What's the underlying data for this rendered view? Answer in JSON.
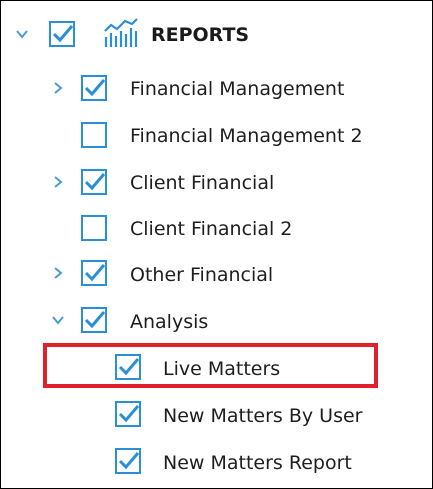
{
  "root": {
    "label": "REPORTS",
    "expanded": true,
    "checked": true,
    "icon": "report-chart-icon"
  },
  "items": [
    {
      "label": "Financial Management",
      "checked": true,
      "has_children": true,
      "expanded": false
    },
    {
      "label": "Financial Management 2",
      "checked": false,
      "has_children": false
    },
    {
      "label": "Client Financial",
      "checked": true,
      "has_children": true,
      "expanded": false
    },
    {
      "label": "Client Financial 2",
      "checked": false,
      "has_children": false
    },
    {
      "label": "Other Financial",
      "checked": true,
      "has_children": true,
      "expanded": false
    },
    {
      "label": "Analysis",
      "checked": true,
      "has_children": true,
      "expanded": true,
      "children": [
        {
          "label": "Live Matters",
          "checked": true,
          "highlighted": true
        },
        {
          "label": "New Matters By User",
          "checked": true
        },
        {
          "label": "New Matters Report",
          "checked": true
        }
      ]
    }
  ],
  "colors": {
    "accent": "#2a8fd8",
    "highlight_border": "#e0202a",
    "text": "#1e1e1e",
    "chevron": "#4a9ad6"
  }
}
